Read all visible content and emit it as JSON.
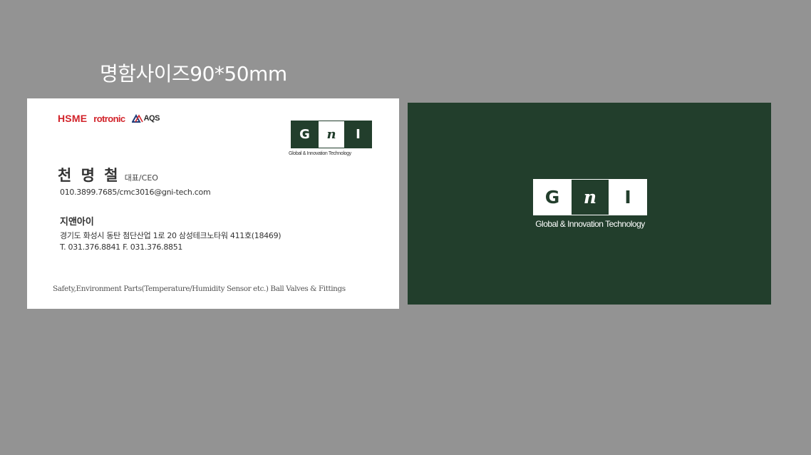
{
  "heading": "명함사이즈90*50mm",
  "front": {
    "brands": {
      "hsme": "HSME",
      "rotronic": "rotronic",
      "aqs": "AQS"
    },
    "logo": {
      "letters": [
        "G",
        "n",
        "I"
      ],
      "tagline": "Global & Innovation Technology"
    },
    "name": "천 명 철",
    "title": "대표/CEO",
    "contact": "010.3899.7685/cmc3016@gni-tech.com",
    "company": "지앤아이",
    "address": "경기도 화성시 동탄 첨단산업 1로 20 삼성테크노타워 411호(18469)",
    "phones": "T. 031.376.8841   F. 031.376.8851",
    "products": "Safety,Environment Parts(Temperature/Humidity Sensor etc.) Ball Valves & Fittings"
  },
  "back": {
    "logo": {
      "letters": [
        "G",
        "n",
        "I"
      ],
      "tagline": "Global & Innovation Technology"
    }
  },
  "colors": {
    "background": "#939393",
    "brand_green": "#223e2c",
    "accent_red": "#d2232a"
  }
}
